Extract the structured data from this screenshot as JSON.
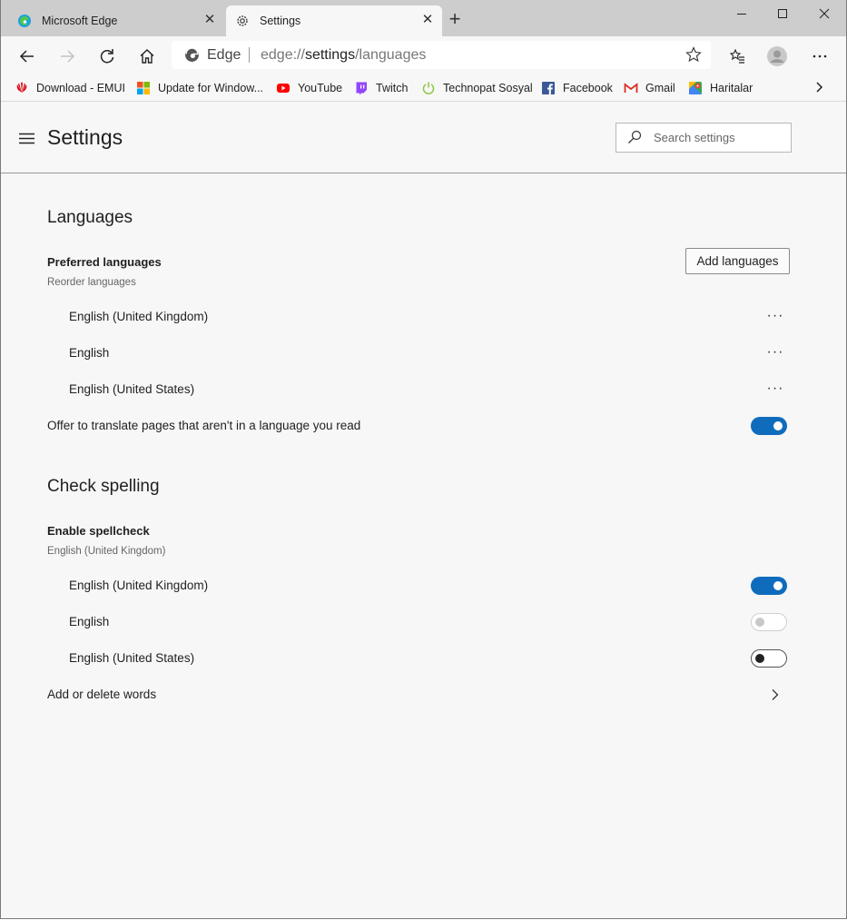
{
  "tabs": [
    {
      "title": "Microsoft Edge",
      "icon": "edge-icon"
    },
    {
      "title": "Settings",
      "icon": "gear-icon",
      "active": true
    }
  ],
  "toolbar": {
    "site_label": "Edge",
    "url_prefix": "edge://",
    "url_host": "settings",
    "url_path": "/languages"
  },
  "bookmarks": [
    {
      "label": "Download - EMUI",
      "icon": "huawei-icon"
    },
    {
      "label": "Update for Window...",
      "icon": "windows-icon"
    },
    {
      "label": "YouTube",
      "icon": "youtube-icon"
    },
    {
      "label": "Twitch",
      "icon": "twitch-icon"
    },
    {
      "label": "Technopat Sosyal",
      "icon": "power-icon"
    },
    {
      "label": "Facebook",
      "icon": "facebook-icon"
    },
    {
      "label": "Gmail",
      "icon": "gmail-icon"
    },
    {
      "label": "Haritalar",
      "icon": "maps-icon"
    }
  ],
  "header": {
    "title": "Settings",
    "search_placeholder": "Search settings"
  },
  "languages": {
    "heading": "Languages",
    "preferred_label": "Preferred languages",
    "reorder_label": "Reorder languages",
    "add_button": "Add languages",
    "items": [
      "English (United Kingdom)",
      "English",
      "English (United States)"
    ],
    "more_symbol": "···",
    "translate_label": "Offer to translate pages that aren't in a language you read",
    "translate_on": true
  },
  "spelling": {
    "heading": "Check spelling",
    "enable_label": "Enable spellcheck",
    "enable_sub": "English (United Kingdom)",
    "items": [
      {
        "label": "English (United Kingdom)",
        "state": "on"
      },
      {
        "label": "English",
        "state": "disabled"
      },
      {
        "label": "English (United States)",
        "state": "off"
      }
    ],
    "words_label": "Add or delete words"
  },
  "colors": {
    "accent": "#0f6cbd"
  }
}
